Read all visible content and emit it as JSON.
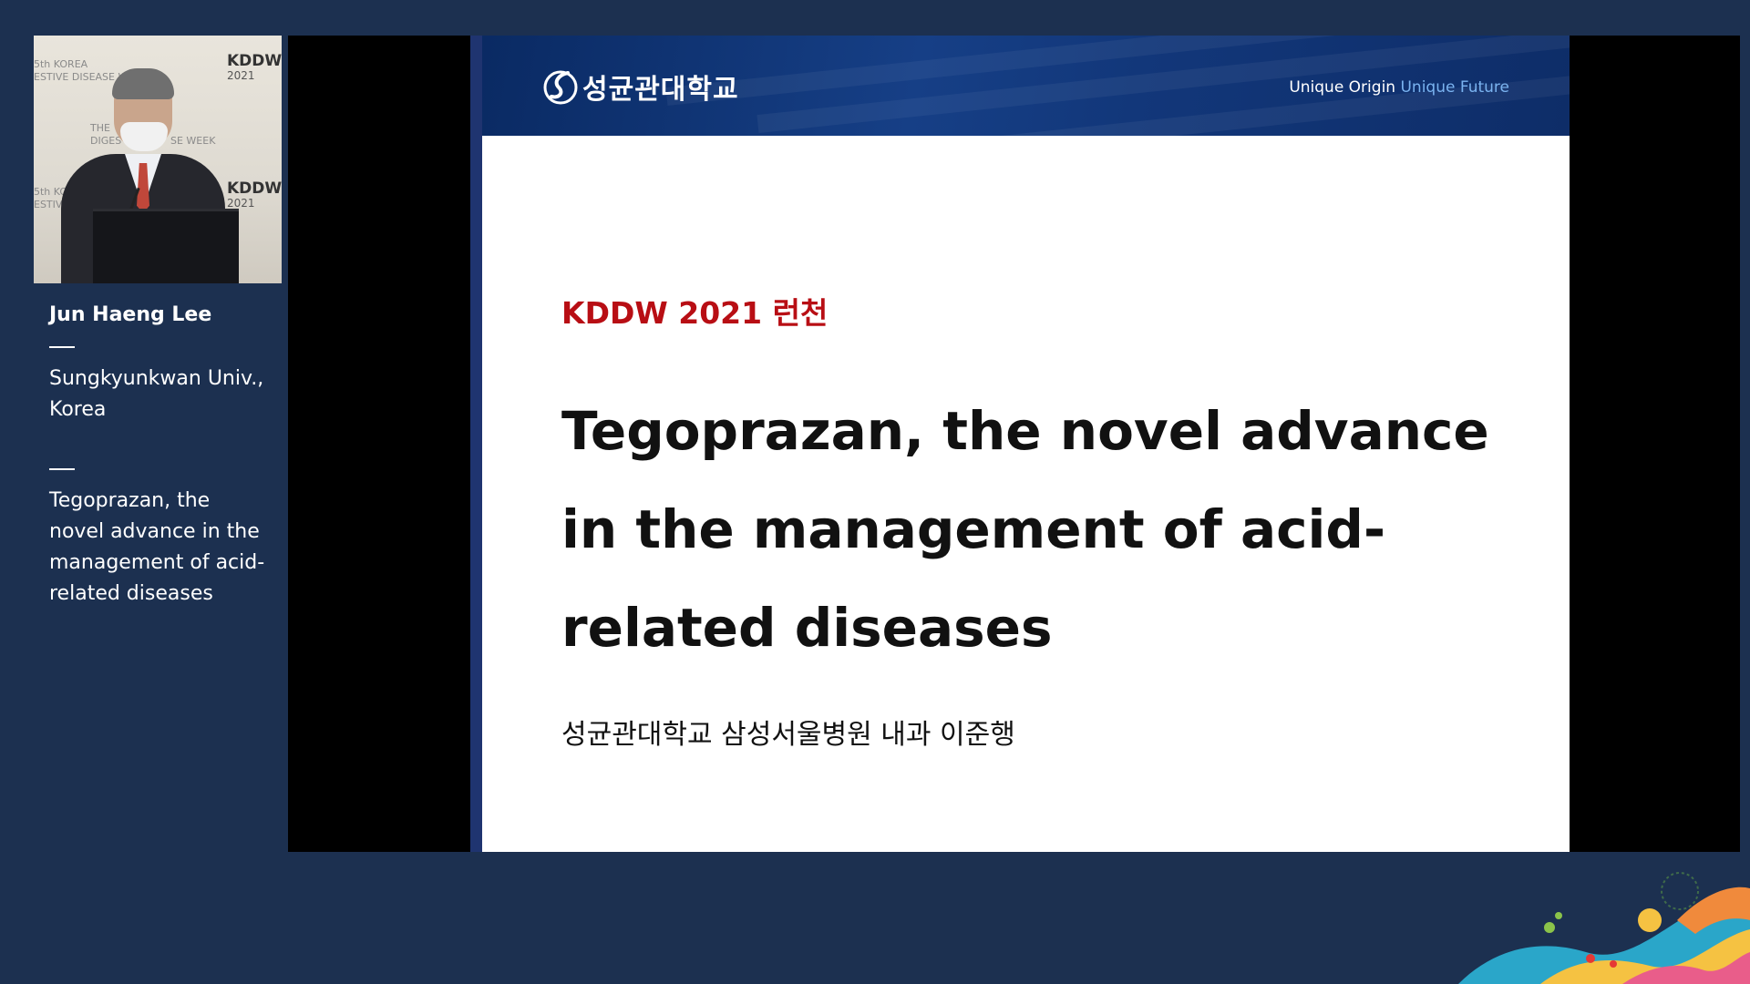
{
  "speaker": {
    "name": "Jun Haeng Lee",
    "affiliation": "Sungkyunkwan Univ., Korea",
    "talk_title": "Tegoprazan, the novel advance in the management of acid-related diseases"
  },
  "video_backdrop": {
    "korea_line": "5th KOREA",
    "disease_week_line": "ESTIVE DISEASE WEEK",
    "the_line": "THE",
    "diges_line": "DIGES",
    "se_week_line": "SE WEEK",
    "kor_line": "5th KOR",
    "estive_line": "ESTIVE",
    "logo_text": "KDDW",
    "logo_year": "2021"
  },
  "slide": {
    "header": {
      "university_logo": "성균관대학교",
      "slogan_part1": "Unique Origin",
      "slogan_part2": "Unique Future"
    },
    "event_line": "KDDW 2021 런천",
    "title": "Tegoprazan, the novel advance in the management of acid-related diseases",
    "presenter_line": "성균관대학교 삼성서울병원 내과 이준행"
  },
  "colors": {
    "background": "#1c3050",
    "slide_header": "#12377a",
    "event_red": "#b80e14",
    "slogan_accent": "#7ab3f0"
  }
}
